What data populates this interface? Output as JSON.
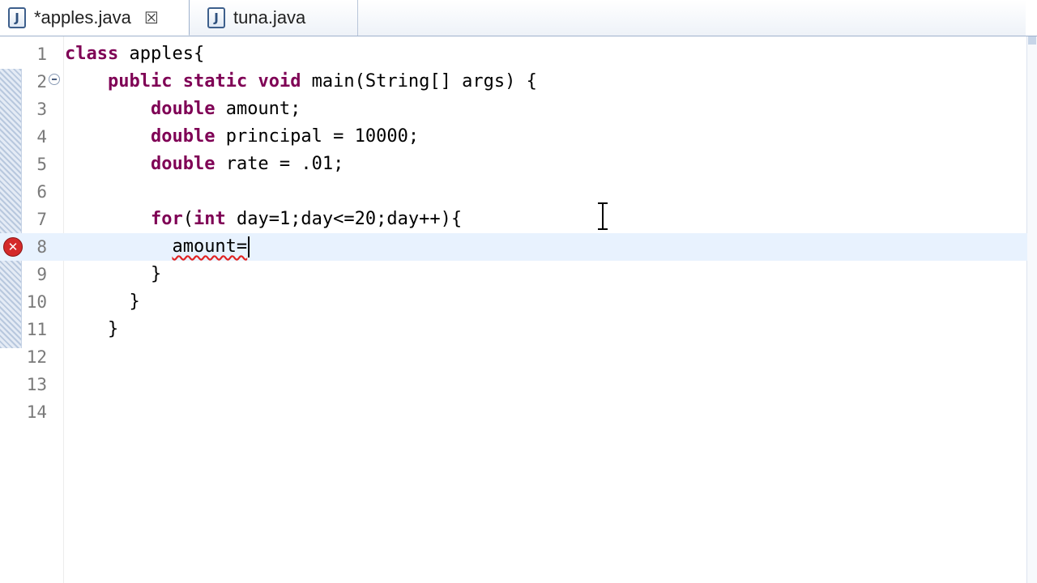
{
  "tabs": [
    {
      "label": "*apples.java",
      "icon": "java-file-icon",
      "icon_glyph": "J",
      "close_glyph": "☒",
      "active": true
    },
    {
      "label": "tuna.java",
      "icon": "java-file-icon",
      "icon_glyph": "J",
      "active": false
    }
  ],
  "editor": {
    "colors": {
      "keyword": "#7f0055",
      "error": "#d42a2a",
      "current_line": "#e8f2fe"
    },
    "lines": [
      {
        "num": "1",
        "text": "class apples{"
      },
      {
        "num": "2",
        "text": "    public static void main(String[] args) {"
      },
      {
        "num": "3",
        "text": "        double amount;"
      },
      {
        "num": "4",
        "text": "        double principal = 10000;"
      },
      {
        "num": "5",
        "text": "        double rate = .01;"
      },
      {
        "num": "6",
        "text": ""
      },
      {
        "num": "7",
        "text": "        for(int day=1;day<=20;day++){"
      },
      {
        "num": "8",
        "text": "amount="
      },
      {
        "num": "9",
        "text": "        }"
      },
      {
        "num": "10",
        "text": "    }"
      },
      {
        "num": "11",
        "text": "    }"
      },
      {
        "num": "12",
        "text": ""
      },
      {
        "num": "13",
        "text": ""
      },
      {
        "num": "14",
        "text": ""
      }
    ],
    "error_marker_glyph": "✕"
  }
}
